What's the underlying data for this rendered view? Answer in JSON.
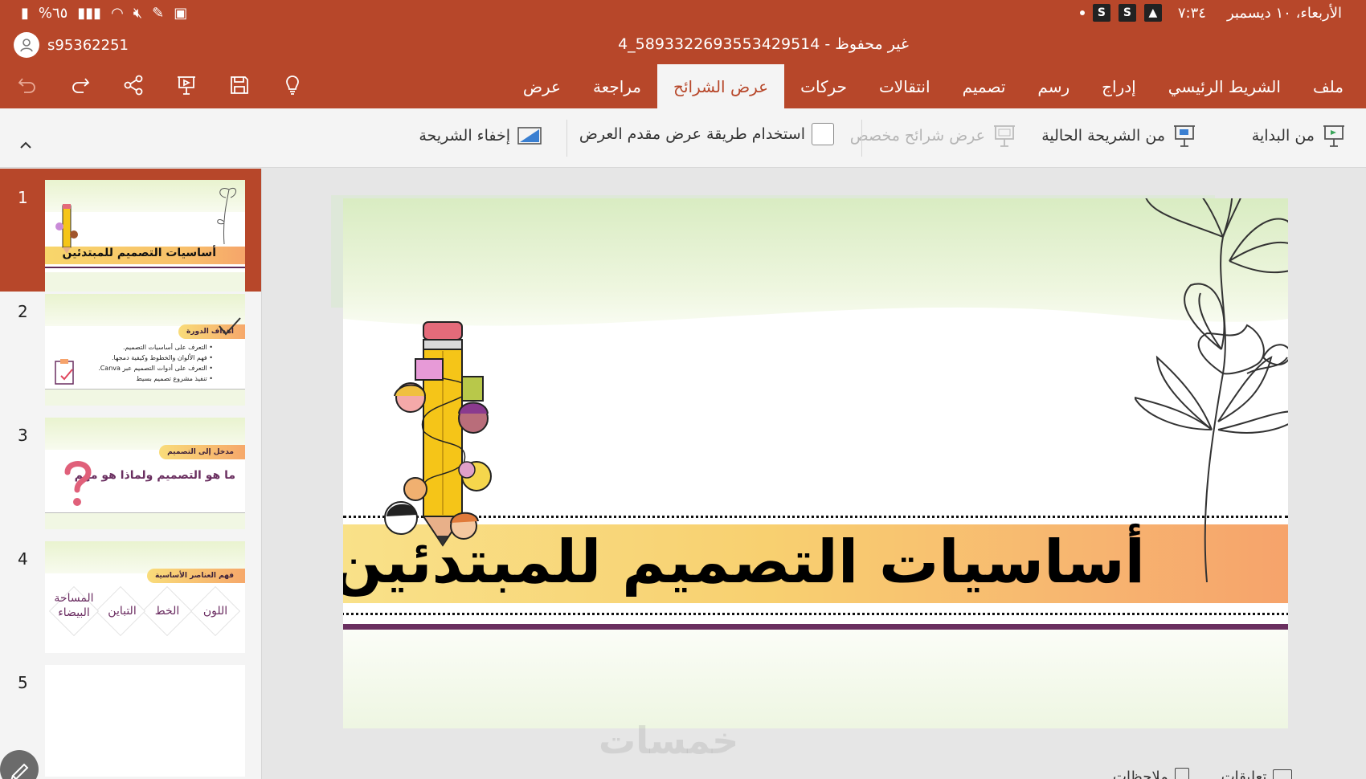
{
  "status_bar": {
    "datetime": "الأربعاء، ١٠ ديسمبر",
    "time": "٧:٣٤",
    "battery": "%٦٥",
    "s_badge": "S"
  },
  "account": {
    "username": "s95362251"
  },
  "document": {
    "title": "4_5893322693553429514 - غير محفوظ"
  },
  "tabs": [
    {
      "label": "ملف",
      "active": false
    },
    {
      "label": "الشريط الرئيسي",
      "active": false
    },
    {
      "label": "إدراج",
      "active": false
    },
    {
      "label": "رسم",
      "active": false
    },
    {
      "label": "تصميم",
      "active": false
    },
    {
      "label": "انتقالات",
      "active": false
    },
    {
      "label": "حركات",
      "active": false
    },
    {
      "label": "عرض الشرائح",
      "active": true
    },
    {
      "label": "مراجعة",
      "active": false
    },
    {
      "label": "عرض",
      "active": false
    }
  ],
  "quick_tools": [
    "undo-icon",
    "redo-icon",
    "share-icon",
    "present-icon",
    "save-icon",
    "lightbulb-icon"
  ],
  "ribbon": {
    "from_beginning": "من البداية",
    "from_current": "من الشريحة الحالية",
    "custom_show": "عرض شرائح مخصص",
    "presenter_view": "استخدام طريقة عرض مقدم العرض",
    "hide_slide": "إخفاء الشريحة"
  },
  "thumbnails": [
    {
      "number": "1",
      "title": "أساسيات التصميم للمبتدئين"
    },
    {
      "number": "2",
      "heading": "أهداف الدورة",
      "bullets": [
        "التعرف على أساسيات التصميم.",
        "فهم الألوان والخطوط وكيفية دمجها.",
        "التعرف على أدوات التصميم عبر Canva.",
        "تنفيذ مشروع تصميم بسيط"
      ]
    },
    {
      "number": "3",
      "heading": "مدخل إلى التصميم",
      "body": "ما هو التصميم ولماذا هو مهم"
    },
    {
      "number": "4",
      "heading": "فهم العناصر الأساسية",
      "items": [
        "اللون",
        "الخط",
        "التباين",
        "المساحة البيضاء"
      ]
    },
    {
      "number": "5"
    }
  ],
  "slide": {
    "title": "أساسيات التصميم للمبتدئين"
  },
  "footer": {
    "comments": "تعليقات",
    "notes": "ملاحظات",
    "watermark": "خمسات"
  },
  "colors": {
    "brand": "#b7472a",
    "ribbon_bg": "#f4f4f4",
    "band_left": "#f9e189",
    "band_right": "#f6a36b",
    "accent_purple": "#6a2f60"
  }
}
